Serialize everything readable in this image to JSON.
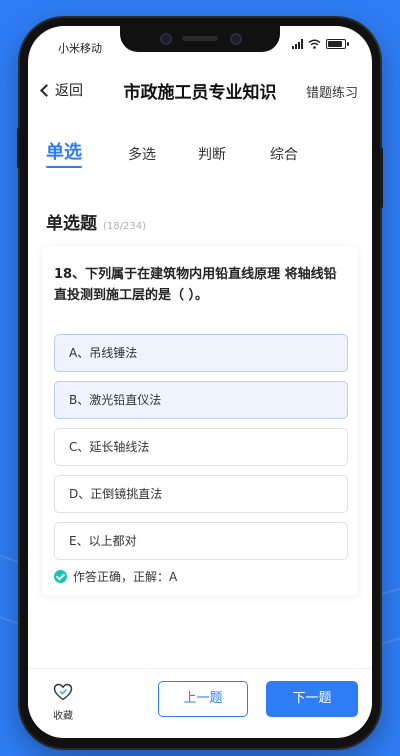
{
  "status": {
    "carrier": "小米移动"
  },
  "nav": {
    "back_label": "返回",
    "title": "市政施工员专业知识",
    "right_label": "错题练习"
  },
  "tabs": [
    {
      "label": "单选",
      "active": true
    },
    {
      "label": "多选"
    },
    {
      "label": "判断"
    },
    {
      "label": "综合"
    }
  ],
  "section": {
    "title": "单选题",
    "counter": "(18/234)"
  },
  "question": {
    "text": "18、下列属于在建筑物内用铅直线原理 将轴线铅直投测到施工层的是（ ）。",
    "options": [
      {
        "label": "A、吊线锤法",
        "selected": true
      },
      {
        "label": "B、激光铅直仪法",
        "selected": true
      },
      {
        "label": "C、延长轴线法"
      },
      {
        "label": "D、正倒镜挑直法"
      },
      {
        "label": "E、以上都对"
      }
    ],
    "result": "作答正确，正解：A"
  },
  "bottom": {
    "favorite_label": "收藏",
    "prev_label": "上一题",
    "next_label": "下一题"
  },
  "colors": {
    "accent": "#2f7df5",
    "success": "#19c2b7",
    "selected_bg": "#eef3fd"
  }
}
